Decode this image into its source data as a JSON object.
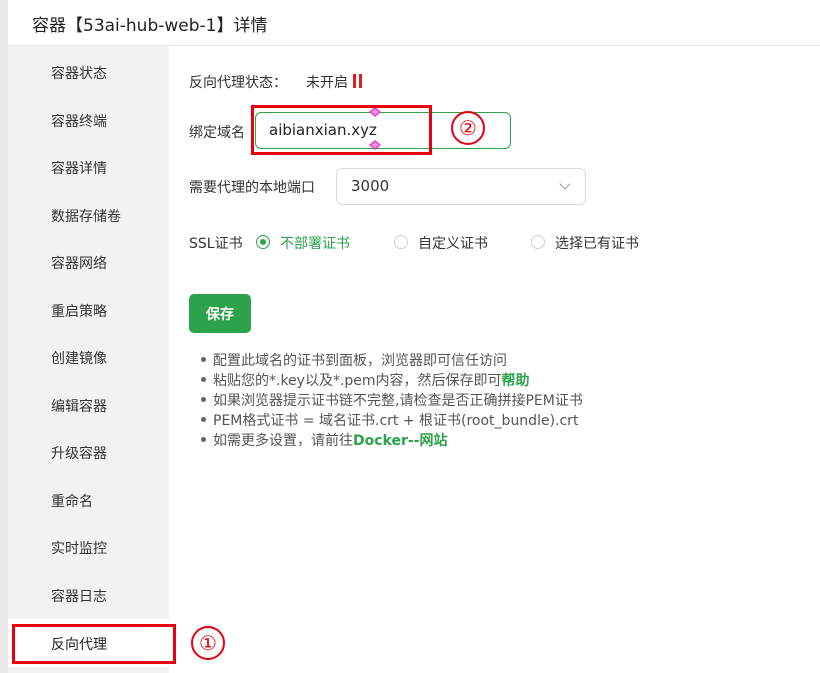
{
  "window": {
    "title": "容器【53ai-hub-web-1】详情"
  },
  "sidebar": {
    "items": [
      {
        "label": "容器状态"
      },
      {
        "label": "容器终端"
      },
      {
        "label": "容器详情"
      },
      {
        "label": "数据存储卷"
      },
      {
        "label": "容器网络"
      },
      {
        "label": "重启策略"
      },
      {
        "label": "创建镜像"
      },
      {
        "label": "编辑容器"
      },
      {
        "label": "升级容器"
      },
      {
        "label": "重命名"
      },
      {
        "label": "实时监控"
      },
      {
        "label": "容器日志"
      },
      {
        "label": "反向代理"
      }
    ],
    "active_index": 12
  },
  "proxy": {
    "status_label": "反向代理状态：",
    "status_value": "未开启",
    "status_color": "#e02020",
    "domain_label": "绑定域名",
    "domain_value": "aibianxian.xyz",
    "port_label": "需要代理的本地端口",
    "port_value": "3000",
    "ssl_label": "SSL证书",
    "ssl_options": [
      {
        "label": "不部署证书",
        "checked": true
      },
      {
        "label": "自定义证书",
        "checked": false
      },
      {
        "label": "选择已有证书",
        "checked": false
      }
    ],
    "save_label": "保存"
  },
  "tips": {
    "line1": "配置此域名的证书到面板，浏览器即可信任访问",
    "line2_prefix": "粘贴您的*.key以及*.pem内容，然后保存即可",
    "line2_link": "帮助",
    "line3": "如果浏览器提示证书链不完整,请检查是否正确拼接PEM证书",
    "line4": "PEM格式证书 = 域名证书.crt + 根证书(root_bundle).crt",
    "line5_prefix": "如需更多设置，请前往",
    "line5_link": "Docker--网站"
  },
  "annotations": {
    "marker1": "①",
    "marker2": "②",
    "color": "#e8000f"
  },
  "colors": {
    "accent": "#2ca24a",
    "sidebar_bg": "#f2f2f2"
  }
}
